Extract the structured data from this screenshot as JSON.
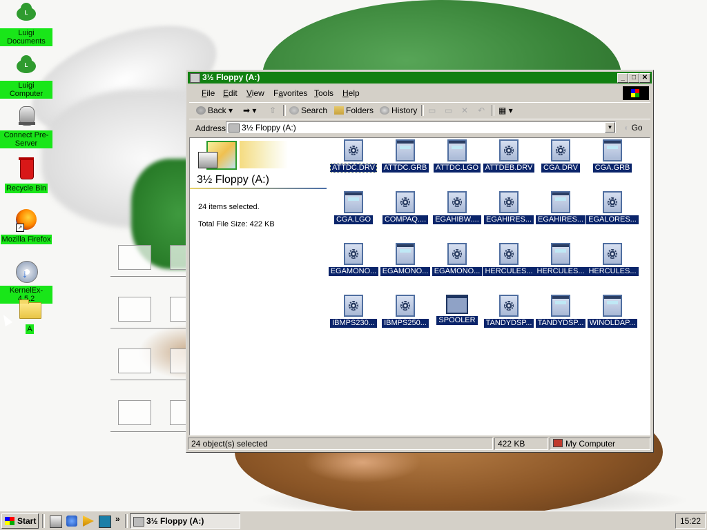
{
  "desktop": {
    "icons": [
      {
        "label": "Luigi Documents",
        "icon": "luigi-cloud-icon"
      },
      {
        "label": "Luigi Computer",
        "icon": "luigi-cloud-icon"
      },
      {
        "label": "Connect Pre-Server",
        "icon": "server-icon"
      },
      {
        "label": "Recycle Bin",
        "icon": "recycle-bin-icon"
      },
      {
        "label": "Mozilla Firefox",
        "icon": "firefox-icon"
      },
      {
        "label": "KernelEx-4.5.2",
        "icon": "installer-cd-icon"
      },
      {
        "label": "A",
        "icon": "folder-icon"
      }
    ],
    "cloud_text": "L"
  },
  "window": {
    "title": "3½ Floppy (A:)",
    "menu": [
      "File",
      "Edit",
      "View",
      "Favorites",
      "Tools",
      "Help"
    ],
    "menu_underline": [
      "F",
      "E",
      "V",
      "a",
      "T",
      "H"
    ],
    "toolbar": {
      "back": "Back",
      "search": "Search",
      "folders": "Folders",
      "history": "History"
    },
    "address": {
      "label": "Address",
      "value": "3½ Floppy (A:)",
      "go": "Go"
    },
    "panel": {
      "title": "3½ Floppy (A:)",
      "selected": "24 items selected.",
      "total": "Total File Size: 422 KB"
    },
    "files": [
      {
        "name": "ATTDC.DRV",
        "type": "driver"
      },
      {
        "name": "ATTDC.GRB",
        "type": "doc"
      },
      {
        "name": "ATTDC.LGO",
        "type": "doc"
      },
      {
        "name": "ATTDEB.DRV",
        "type": "driver"
      },
      {
        "name": "CGA.DRV",
        "type": "driver"
      },
      {
        "name": "CGA.GRB",
        "type": "doc"
      },
      {
        "name": "CGA.LGO",
        "type": "doc"
      },
      {
        "name": "COMPAQ....",
        "type": "driver"
      },
      {
        "name": "EGAHIBW....",
        "type": "driver"
      },
      {
        "name": "EGAHIRES...",
        "type": "driver"
      },
      {
        "name": "EGAHIRES...",
        "type": "doc"
      },
      {
        "name": "EGALORES...",
        "type": "driver"
      },
      {
        "name": "EGAMONO...",
        "type": "driver"
      },
      {
        "name": "EGAMONO...",
        "type": "doc"
      },
      {
        "name": "EGAMONO...",
        "type": "driver"
      },
      {
        "name": "HERCULES...",
        "type": "driver"
      },
      {
        "name": "HERCULES...",
        "type": "doc"
      },
      {
        "name": "HERCULES...",
        "type": "driver"
      },
      {
        "name": "IBMPS230...",
        "type": "driver"
      },
      {
        "name": "IBMPS250...",
        "type": "driver"
      },
      {
        "name": "SPOOLER",
        "type": "app"
      },
      {
        "name": "TANDYDSP...",
        "type": "driver"
      },
      {
        "name": "TANDYDSP...",
        "type": "doc"
      },
      {
        "name": "WINOLDAP...",
        "type": "doc"
      }
    ],
    "status": {
      "objects": "24 object(s) selected",
      "size": "422 KB",
      "zone": "My Computer"
    },
    "colors": {
      "titlebar": "#118011",
      "selection": "#0a246a"
    }
  },
  "taskbar": {
    "start": "Start",
    "task": "3½ Floppy (A:)",
    "more": "»",
    "clock": "15:22"
  }
}
